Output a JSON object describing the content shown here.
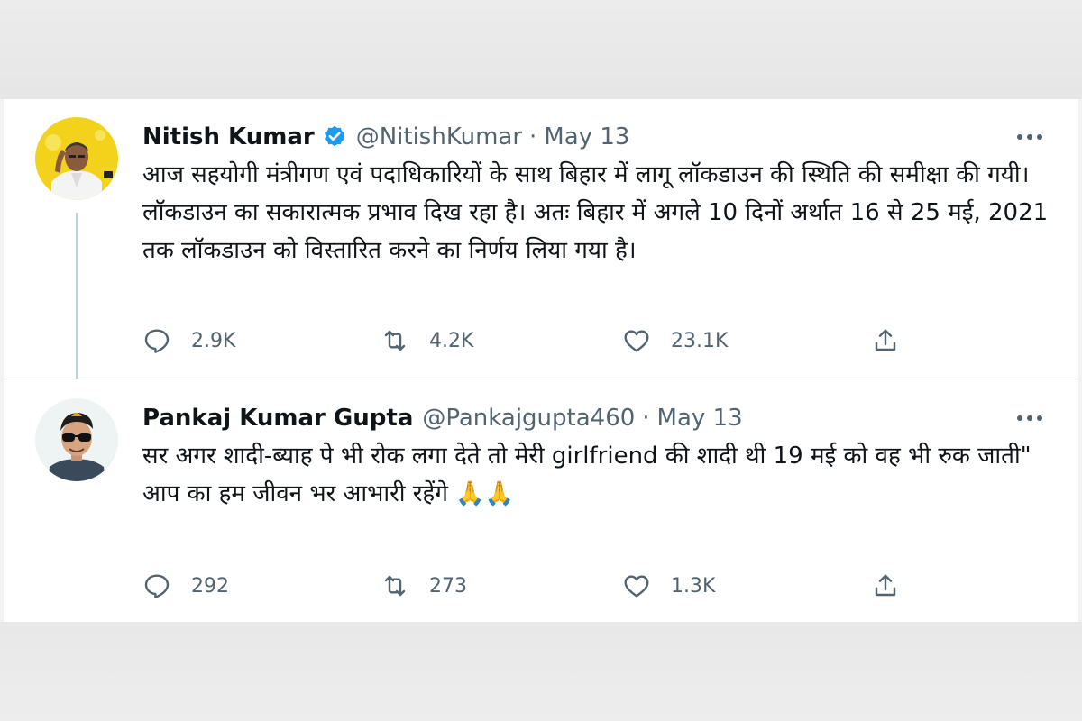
{
  "tweets": [
    {
      "display_name": "Nitish Kumar",
      "verified": true,
      "handle": "@NitishKumar",
      "separator": "·",
      "date": "May 13",
      "text_lines": [
        "आज सहयोगी मंत्रीगण एवं पदाधिकारियों के साथ बिहार में लागू लॉकडाउन की स्थिति की समीक्षा की गयी। लॉकडाउन का सकारात्मक प्रभाव दिख रहा है। अतः बिहार में अगले 10 दिनों अर्थात 16 से 25 मई, 2021 तक लॉकडाउन को विस्तारित करने का निर्णय लिया गया है।"
      ],
      "actions": {
        "replies": "2.9K",
        "retweets": "4.2K",
        "likes": "23.1K"
      },
      "avatar_icon": "politician-portrait-avatar"
    },
    {
      "display_name": "Pankaj Kumar Gupta",
      "verified": false,
      "handle": "@Pankajgupta460",
      "separator": "·",
      "date": "May 13",
      "text_lines": [
        "सर अगर शादी-ब्याह पे भी रोक लगा देते तो मेरी girlfriend की शादी थी 19 मई को वह भी रुक जाती\"",
        "आप का हम जीवन भर आभारी रहेंगे 🙏🙏"
      ],
      "actions": {
        "replies": "292",
        "retweets": "273",
        "likes": "1.3K"
      },
      "avatar_icon": "man-with-sunglasses-avatar"
    }
  ],
  "icons": {
    "reply": "reply-bubble-icon",
    "retweet": "retweet-icon",
    "like": "heart-icon",
    "share": "share-icon",
    "more": "more-dots-icon",
    "verified": "verified-badge-icon"
  },
  "colors": {
    "text_primary": "#0f1419",
    "text_secondary": "#536471",
    "verified_blue": "#1d9bf0",
    "thread_line": "#c4cfd6",
    "divider": "#e7e9ea",
    "avatar_bg_yellow": "#f2d21b"
  }
}
